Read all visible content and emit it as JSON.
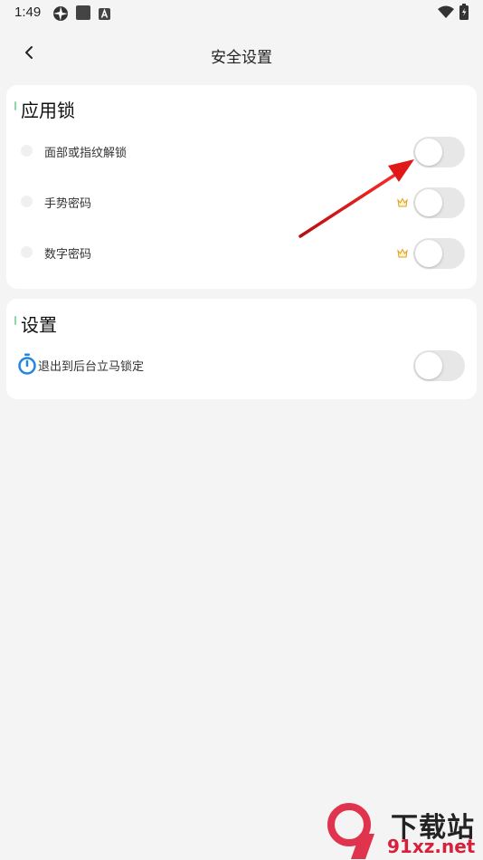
{
  "status_bar": {
    "time": "1:49",
    "icons": [
      "aperture-icon",
      "square-app-icon",
      "a-box-icon",
      "wifi-icon",
      "battery-icon"
    ]
  },
  "header": {
    "title": "安全设置",
    "back_icon": "chevron-left-icon"
  },
  "sections": [
    {
      "title": "应用锁",
      "rows": [
        {
          "label": "面部或指纹解锁",
          "premium": false,
          "enabled": false
        },
        {
          "label": "手势密码",
          "premium": true,
          "enabled": false
        },
        {
          "label": "数字密码",
          "premium": true,
          "enabled": false
        }
      ]
    },
    {
      "title": "设置",
      "rows": [
        {
          "label": "退出到后台立马锁定",
          "icon": "timer-icon",
          "enabled": false
        }
      ]
    }
  ],
  "watermark": {
    "brand": "下载站",
    "url": "91xz.net"
  },
  "colors": {
    "background": "#f4f4f4",
    "card": "#ffffff",
    "toggle_off": "#e7e7e7",
    "arrow": "#e01818",
    "accent_marker": "#8fd6a6",
    "timer_blue": "#1f86e8",
    "crown_gold": "#e0a021"
  }
}
